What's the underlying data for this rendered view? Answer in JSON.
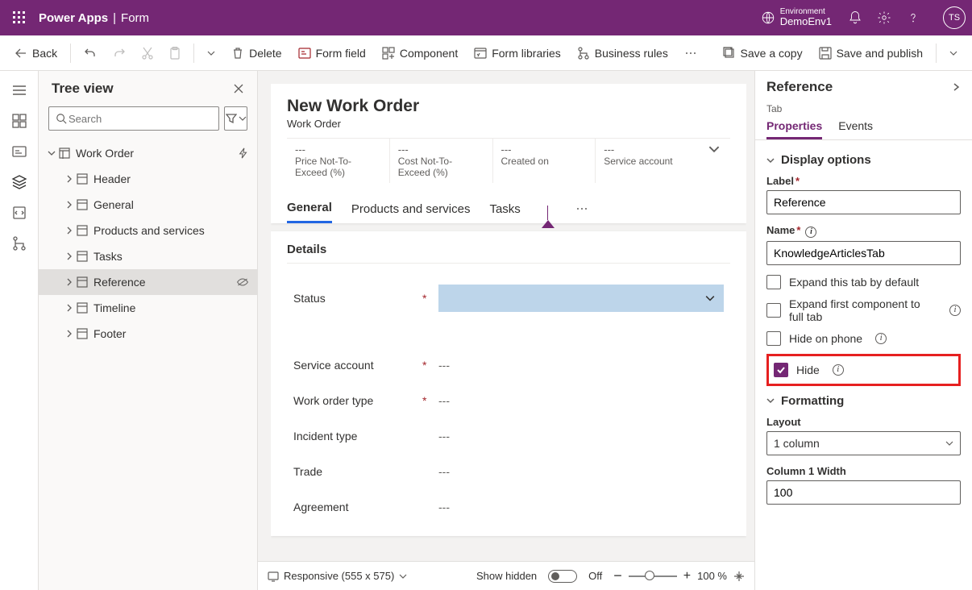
{
  "header": {
    "app": "Power Apps",
    "context": "Form",
    "env_label": "Environment",
    "env_value": "DemoEnv1",
    "avatar": "TS"
  },
  "cmd": {
    "back": "Back",
    "delete": "Delete",
    "form_field": "Form field",
    "component": "Component",
    "libraries": "Form libraries",
    "rules": "Business rules",
    "save_copy": "Save a copy",
    "publish": "Save and publish"
  },
  "tree": {
    "title": "Tree view",
    "search_placeholder": "Search",
    "root": "Work Order",
    "items": [
      "Header",
      "General",
      "Products and services",
      "Tasks",
      "Reference",
      "Timeline",
      "Footer"
    ],
    "selected_index": 4
  },
  "canvas": {
    "title": "New Work Order",
    "entity": "Work Order",
    "summary": [
      {
        "v": "---",
        "l": "Price Not-To-Exceed (%)"
      },
      {
        "v": "---",
        "l": "Cost Not-To-Exceed (%)"
      },
      {
        "v": "---",
        "l": "Created on"
      },
      {
        "v": "---",
        "l": "Service account"
      }
    ],
    "tabs": [
      "General",
      "Products and services",
      "Tasks"
    ],
    "section": "Details",
    "fields": [
      {
        "l": "Status",
        "req": true,
        "input": true
      },
      {
        "l": "Service account",
        "req": true,
        "v": "---"
      },
      {
        "l": "Work order type",
        "req": true,
        "v": "---"
      },
      {
        "l": "Incident type",
        "req": false,
        "v": "---"
      },
      {
        "l": "Trade",
        "req": false,
        "v": "---"
      },
      {
        "l": "Agreement",
        "req": false,
        "v": "---"
      }
    ],
    "footer": {
      "responsive": "Responsive (555 x 575)",
      "show_hidden": "Show hidden",
      "toggle": "Off",
      "zoom": "100 %"
    }
  },
  "props": {
    "title": "Reference",
    "type": "Tab",
    "tabs": [
      "Properties",
      "Events"
    ],
    "display": "Display options",
    "label_l": "Label",
    "label_v": "Reference",
    "name_l": "Name",
    "name_v": "KnowledgeArticlesTab",
    "expand_default": "Expand this tab by default",
    "expand_full": "Expand first component to full tab",
    "hide_phone": "Hide on phone",
    "hide": "Hide",
    "formatting": "Formatting",
    "layout_l": "Layout",
    "layout_v": "1 column",
    "col_width_l": "Column 1 Width",
    "col_width_v": "100"
  }
}
